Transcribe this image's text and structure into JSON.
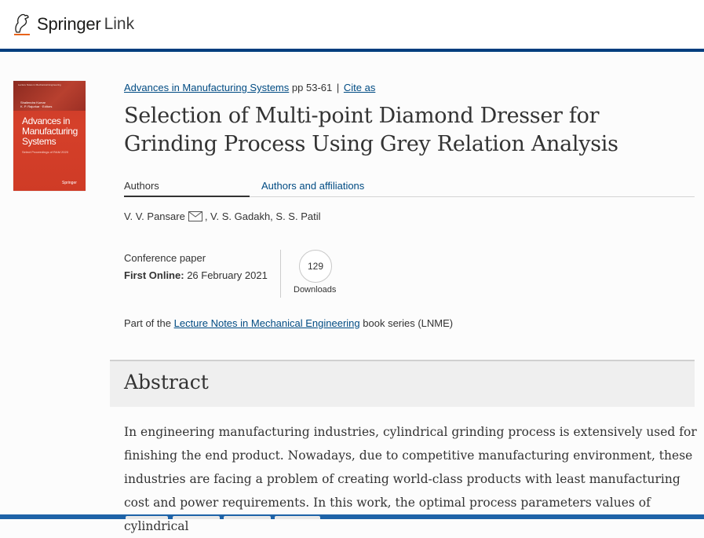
{
  "header": {
    "brand_springer": "Springer",
    "brand_link": "Link"
  },
  "cover": {
    "series": "Lecture Notes in Mechanical Engineering",
    "editors": [
      "Shailendra Kumar",
      "K. P. Rajurkar · Editors"
    ],
    "title": "Advances in Manufacturing Systems",
    "subtitle": "Select Proceedings of RAM 2020",
    "publisher": "Springer"
  },
  "breadcrumb": {
    "book": "Advances in Manufacturing Systems",
    "pages": "pp 53-61",
    "separator": "|",
    "cite": "Cite as"
  },
  "title": "Selection of Multi-point Diamond Dresser for Grinding Process Using Grey Relation Analysis",
  "tabs": {
    "authors": "Authors",
    "affiliations": "Authors and affiliations"
  },
  "authors": {
    "first": "V. V. Pansare",
    "rest": ", V. S. Gadakh, S. S. Patil"
  },
  "meta": {
    "type": "Conference paper",
    "first_online_label": "First Online:",
    "first_online_date": "26 February 2021",
    "downloads_count": "129",
    "downloads_label": "Downloads"
  },
  "series": {
    "prefix": "Part of the",
    "link": "Lecture Notes in Mechanical Engineering",
    "suffix": "book series (LNME)"
  },
  "abstract": {
    "heading": "Abstract",
    "text": "In engineering manufacturing industries, cylindrical grinding process is extensively used for finishing the end product. Nowadays, due to competitive manufacturing environment, these industries are facing a problem of creating world-class products with least manufacturing cost and power requirements. In this work, the optimal process parameters values of cylindrical"
  },
  "colors": {
    "header_rule": "#003e7e",
    "link": "#004b83",
    "cover_red": "#d5402a"
  }
}
